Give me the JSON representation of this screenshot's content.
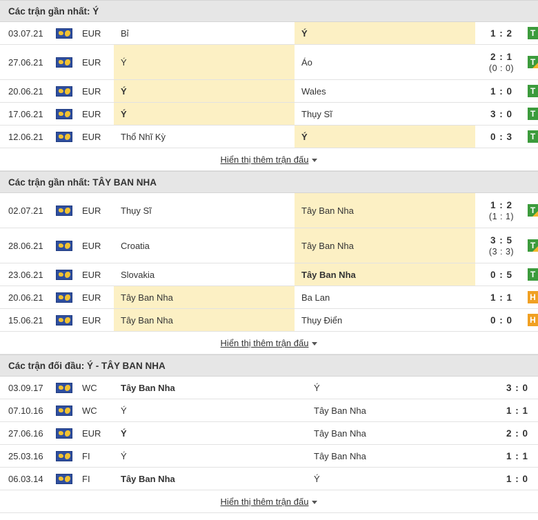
{
  "sections": [
    {
      "title": "Các trận gần nhất: Ý",
      "more": "Hiển thị thêm trận đấu",
      "matches": [
        {
          "date": "03.07.21",
          "comp": "EUR",
          "home": "Bỉ",
          "away": "Ý",
          "score": "1 : 2",
          "ht": "",
          "res": "T"
        },
        {
          "date": "27.06.21",
          "comp": "EUR",
          "home": "Ý",
          "away": "Áo",
          "score": "2 : 1",
          "ht": "(0 : 0)",
          "res": "T"
        },
        {
          "date": "20.06.21",
          "comp": "EUR",
          "home": "Ý",
          "away": "Wales",
          "score": "1 : 0",
          "ht": "",
          "res": "T"
        },
        {
          "date": "17.06.21",
          "comp": "EUR",
          "home": "Ý",
          "away": "Thụy Sĩ",
          "score": "3 : 0",
          "ht": "",
          "res": "T"
        },
        {
          "date": "12.06.21",
          "comp": "EUR",
          "home": "Thổ Nhĩ Kỳ",
          "away": "Ý",
          "score": "0 : 3",
          "ht": "",
          "res": "T"
        }
      ]
    },
    {
      "title": "Các trận gần nhất: TÂY BAN NHA",
      "more": "Hiển thị thêm trận đấu",
      "matches": [
        {
          "date": "02.07.21",
          "comp": "EUR",
          "home": "Thụy Sĩ",
          "away": "Tây Ban Nha",
          "score": "1 : 2",
          "ht": "(1 : 1)",
          "res": "T"
        },
        {
          "date": "28.06.21",
          "comp": "EUR",
          "home": "Croatia",
          "away": "Tây Ban Nha",
          "score": "3 : 5",
          "ht": "(3 : 3)",
          "res": "T"
        },
        {
          "date": "23.06.21",
          "comp": "EUR",
          "home": "Slovakia",
          "away": "Tây Ban Nha",
          "score": "0 : 5",
          "ht": "",
          "res": "T"
        },
        {
          "date": "20.06.21",
          "comp": "EUR",
          "home": "Tây Ban Nha",
          "away": "Ba Lan",
          "score": "1 : 1",
          "ht": "",
          "res": "H"
        },
        {
          "date": "15.06.21",
          "comp": "EUR",
          "home": "Tây Ban Nha",
          "away": "Thụy Điển",
          "score": "0 : 0",
          "ht": "",
          "res": "H"
        }
      ]
    },
    {
      "title": "Các trận đối đầu: Ý - TÂY BAN NHA",
      "more": "Hiển thị thêm trận đấu",
      "matches": [
        {
          "date": "03.09.17",
          "comp": "WC",
          "home": "Tây Ban Nha",
          "away": "Ý",
          "score": "3 : 0"
        },
        {
          "date": "07.10.16",
          "comp": "WC",
          "home": "Ý",
          "away": "Tây Ban Nha",
          "score": "1 : 1"
        },
        {
          "date": "27.06.16",
          "comp": "EUR",
          "home": "Ý",
          "away": "Tây Ban Nha",
          "score": "2 : 0"
        },
        {
          "date": "25.03.16",
          "comp": "FI",
          "home": "Ý",
          "away": "Tây Ban Nha",
          "score": "1 : 1"
        },
        {
          "date": "06.03.14",
          "comp": "FI",
          "home": "Tây Ban Nha",
          "away": "Ý",
          "score": "1 : 0"
        }
      ]
    }
  ]
}
